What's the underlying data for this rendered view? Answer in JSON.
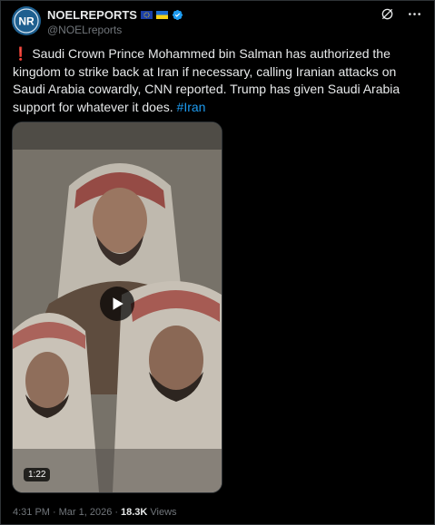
{
  "author": {
    "display_name": "NOELREPORTS",
    "handle": "@NOELreports",
    "avatar_text": "NR",
    "verified": true
  },
  "tweet": {
    "alert_emoji": "❗",
    "text": "Saudi Crown Prince Mohammed bin Salman has authorized the kingdom to strike back at Iran if necessary, calling Iranian attacks on Saudi Arabia cowardly, CNN reported. Trump has given Saudi Arabia support for whatever it does.",
    "hashtag": "#Iran"
  },
  "media": {
    "type": "video",
    "duration": "1:22"
  },
  "meta": {
    "time": "4:31 PM",
    "separator": "·",
    "date": "Mar 1, 2026",
    "views_count": "18.3K",
    "views_label": "Views"
  },
  "colors": {
    "accent": "#1d9bf0",
    "background": "#000000",
    "text": "#e7e9ea",
    "muted": "#71767b"
  },
  "icons": [
    "grok-icon",
    "more-icon",
    "play-icon",
    "verified-badge-icon",
    "eu-flag-icon",
    "ukraine-flag-icon"
  ]
}
